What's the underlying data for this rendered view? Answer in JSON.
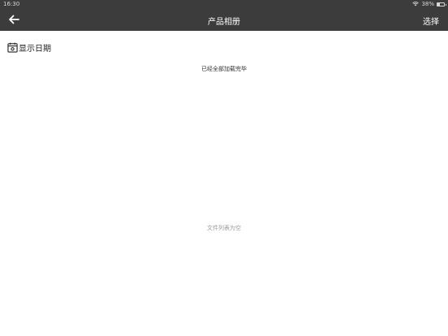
{
  "status_bar": {
    "time": "16:30",
    "battery_percent": "38%",
    "battery_level": 0.38
  },
  "nav": {
    "title": "产品相册",
    "select_label": "选择"
  },
  "date_toggle": {
    "label": "显示日期"
  },
  "list": {
    "loaded_message": "已经全部加载完毕",
    "empty_message": "文件列表为空"
  },
  "colors": {
    "nav_background": "#3c3c3c",
    "page_background": "#ffffff"
  }
}
